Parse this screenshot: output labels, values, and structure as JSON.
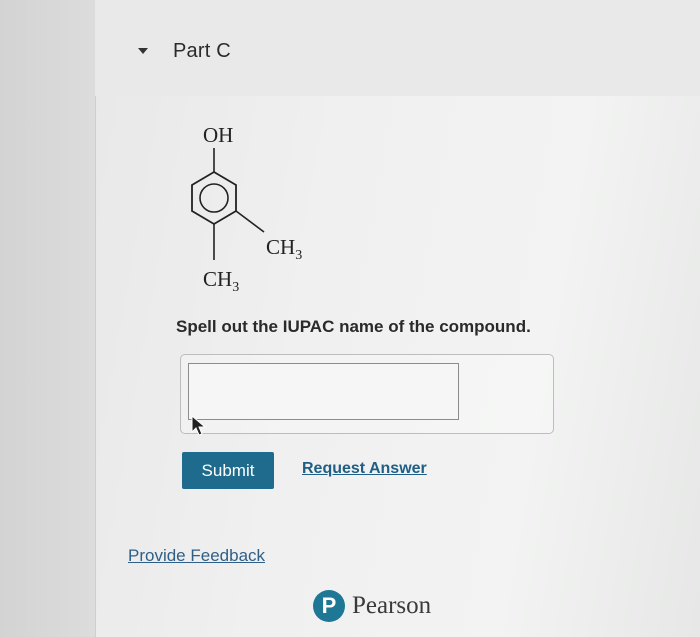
{
  "part": {
    "title": "Part C"
  },
  "structure": {
    "top_group": "OH",
    "side_group": "CH",
    "side_group_sub": "3",
    "bottom_group": "CH",
    "bottom_group_sub": "3"
  },
  "question": {
    "text": "Spell out the IUPAC name of the compound."
  },
  "answer": {
    "value": "",
    "placeholder": ""
  },
  "actions": {
    "submit_label": "Submit",
    "request_answer_label": "Request Answer"
  },
  "feedback": {
    "label": "Provide Feedback"
  },
  "footer": {
    "logo_mark": "P",
    "brand": "Pearson"
  },
  "colors": {
    "submit_bg": "#1e6b8d",
    "link": "#1f5f86",
    "logo": "#1e7795"
  },
  "icons": [
    "caret-down-icon",
    "mouse-pointer-icon",
    "pearson-logo"
  ]
}
